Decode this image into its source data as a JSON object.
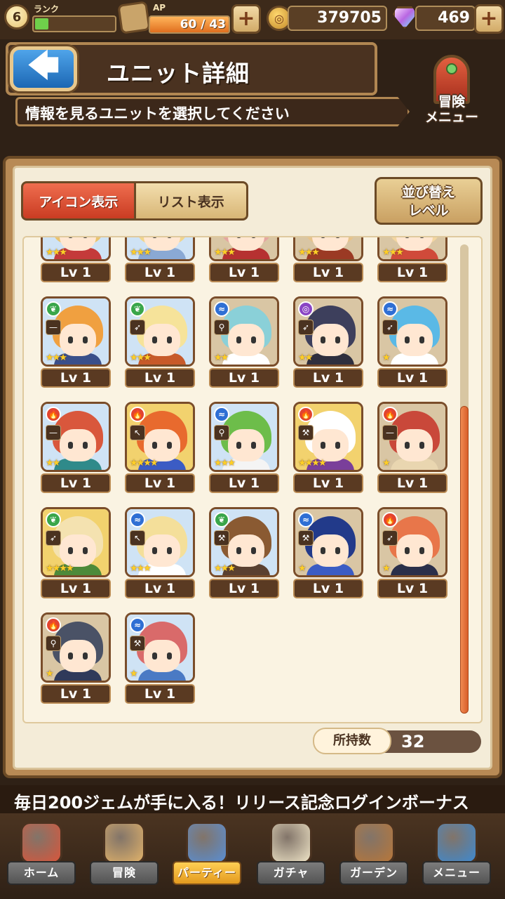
{
  "status": {
    "rank_value": "6",
    "rank_label": "ランク",
    "rank_progress": 0.16,
    "ap_label": "AP",
    "ap_text": "60 / 43",
    "ap_progress": 1.0,
    "gold": "379705",
    "gems": "469",
    "plus_symbol": "+"
  },
  "header": {
    "back_arrow": "🡄",
    "title": "ユニット詳細",
    "subtitle": "情報を見るユニットを選択してください"
  },
  "adventure_menu": {
    "label_line1": "冒険",
    "label_line2": "メニュー"
  },
  "tabs": {
    "icon_view": "アイコン表示",
    "list_view": "リスト表示"
  },
  "sort": {
    "line1": "並び替え",
    "line2": "レベル"
  },
  "units": [
    {
      "element": "",
      "weapon": "",
      "stars": 3,
      "level": "Lv 1",
      "hair": "#e9c36e",
      "bg": "#cfe3f5",
      "cloth": "#c43a3a"
    },
    {
      "element": "",
      "weapon": "",
      "stars": 3,
      "level": "Lv 1",
      "hair": "#f1d58c",
      "bg": "#cfe3f5",
      "cloth": "#8aa9d4"
    },
    {
      "element": "",
      "weapon": "",
      "stars": 3,
      "level": "Lv 1",
      "hair": "#e4a7a0",
      "bg": "#d9c6a4",
      "cloth": "#b63131"
    },
    {
      "element": "",
      "weapon": "",
      "stars": 3,
      "level": "Lv 1",
      "hair": "#e7c38a",
      "bg": "#d9c6a4",
      "cloth": "#9b3a24"
    },
    {
      "element": "",
      "weapon": "",
      "stars": 3,
      "level": "Lv 1",
      "hair": "#f3d6a0",
      "bg": "#d9c6a4",
      "cloth": "#d04a3a"
    },
    {
      "element": "wind",
      "weapon": "sword",
      "stars": 3,
      "level": "Lv 1",
      "hair": "#f0a040",
      "bg": "#cfe3f5",
      "cloth": "#3a4f8a"
    },
    {
      "element": "wind",
      "weapon": "bow",
      "stars": 3,
      "level": "Lv 1",
      "hair": "#f6e39a",
      "bg": "#cfe3f5",
      "cloth": "#c75a2a"
    },
    {
      "element": "water",
      "weapon": "staff",
      "stars": 2,
      "level": "Lv 1",
      "hair": "#8ad0d8",
      "bg": "#d9c6a4",
      "cloth": "#ffffff"
    },
    {
      "element": "dark",
      "weapon": "bow",
      "stars": 2,
      "level": "Lv 1",
      "hair": "#3d3f5c",
      "bg": "#d9c6a4",
      "cloth": "#2f2f3e"
    },
    {
      "element": "water",
      "weapon": "bow",
      "stars": 1,
      "level": "Lv 1",
      "hair": "#5ab9e6",
      "bg": "#d9c6a4",
      "cloth": "#ffffff"
    },
    {
      "element": "fire",
      "weapon": "sword",
      "stars": 2,
      "level": "Lv 1",
      "hair": "#d9573c",
      "bg": "#cfe3f5",
      "cloth": "#2f8a8a"
    },
    {
      "element": "fire",
      "weapon": "spear",
      "stars": 4,
      "level": "Lv 1",
      "hair": "#e86a2e",
      "bg": "#f2d26e",
      "cloth": "#3b5cc4"
    },
    {
      "element": "water",
      "weapon": "staff",
      "stars": 3,
      "level": "Lv 1",
      "hair": "#6dbd4a",
      "bg": "#cfe3f5",
      "cloth": "#f4f4f4"
    },
    {
      "element": "fire",
      "weapon": "axe",
      "stars": 4,
      "level": "Lv 1",
      "hair": "#ffffff",
      "bg": "#f2d26e",
      "cloth": "#7a3f9a"
    },
    {
      "element": "fire",
      "weapon": "sword",
      "stars": 1,
      "level": "Lv 1",
      "hair": "#c9483a",
      "bg": "#d9c6a4",
      "cloth": "#e9d6b0"
    },
    {
      "element": "wind",
      "weapon": "bow",
      "stars": 4,
      "level": "Lv 1",
      "hair": "#f4e2b0",
      "bg": "#f2d26e",
      "cloth": "#4d8a3a"
    },
    {
      "element": "water",
      "weapon": "spear",
      "stars": 3,
      "level": "Lv 1",
      "hair": "#f4df9a",
      "bg": "#cfe3f5",
      "cloth": "#ffffff"
    },
    {
      "element": "wind",
      "weapon": "axe",
      "stars": 3,
      "level": "Lv 1",
      "hair": "#8a5a32",
      "bg": "#cfe3f5",
      "cloth": "#5a4030"
    },
    {
      "element": "water",
      "weapon": "axe",
      "stars": 1,
      "level": "Lv 1",
      "hair": "#223a8a",
      "bg": "#d9c6a4",
      "cloth": "#3b5cc4"
    },
    {
      "element": "fire",
      "weapon": "bow",
      "stars": 1,
      "level": "Lv 1",
      "hair": "#e8764a",
      "bg": "#d9c6a4",
      "cloth": "#2a2f4a"
    },
    {
      "element": "fire",
      "weapon": "staff",
      "stars": 1,
      "level": "Lv 1",
      "hair": "#4a5266",
      "bg": "#d9c6a4",
      "cloth": "#2f3a5a"
    },
    {
      "element": "water",
      "weapon": "hammer",
      "stars": 1,
      "level": "Lv 1",
      "hair": "#d96a6a",
      "bg": "#cfe3f5",
      "cloth": "#4a7ac4"
    }
  ],
  "owned": {
    "label": "所持数",
    "value": "32"
  },
  "ticker": "毎日200ジェムが手に入る！リリース記念ログインボーナス",
  "nav": [
    {
      "label": "ホーム",
      "color": "#d9573c",
      "active": false
    },
    {
      "label": "冒険",
      "color": "#e1b26a",
      "active": false
    },
    {
      "label": "パーティー",
      "color": "#5a8fd4",
      "active": true
    },
    {
      "label": "ガチャ",
      "color": "#efe4c6",
      "active": false
    },
    {
      "label": "ガーデン",
      "color": "#b8773a",
      "active": false
    },
    {
      "label": "メニュー",
      "color": "#3f8ad0",
      "active": false
    }
  ],
  "colors": {
    "fire": "#e2442f",
    "wind": "#3aa64a",
    "water": "#2f6fd4",
    "dark": "#8a45c4"
  },
  "icons": {
    "fire": "🔥",
    "wind": "❦",
    "water": "≈",
    "dark": "◎",
    "sword": "—",
    "bow": "➶",
    "staff": "⚲",
    "spear": "↖",
    "axe": "⚒",
    "hammer": "⚒"
  }
}
